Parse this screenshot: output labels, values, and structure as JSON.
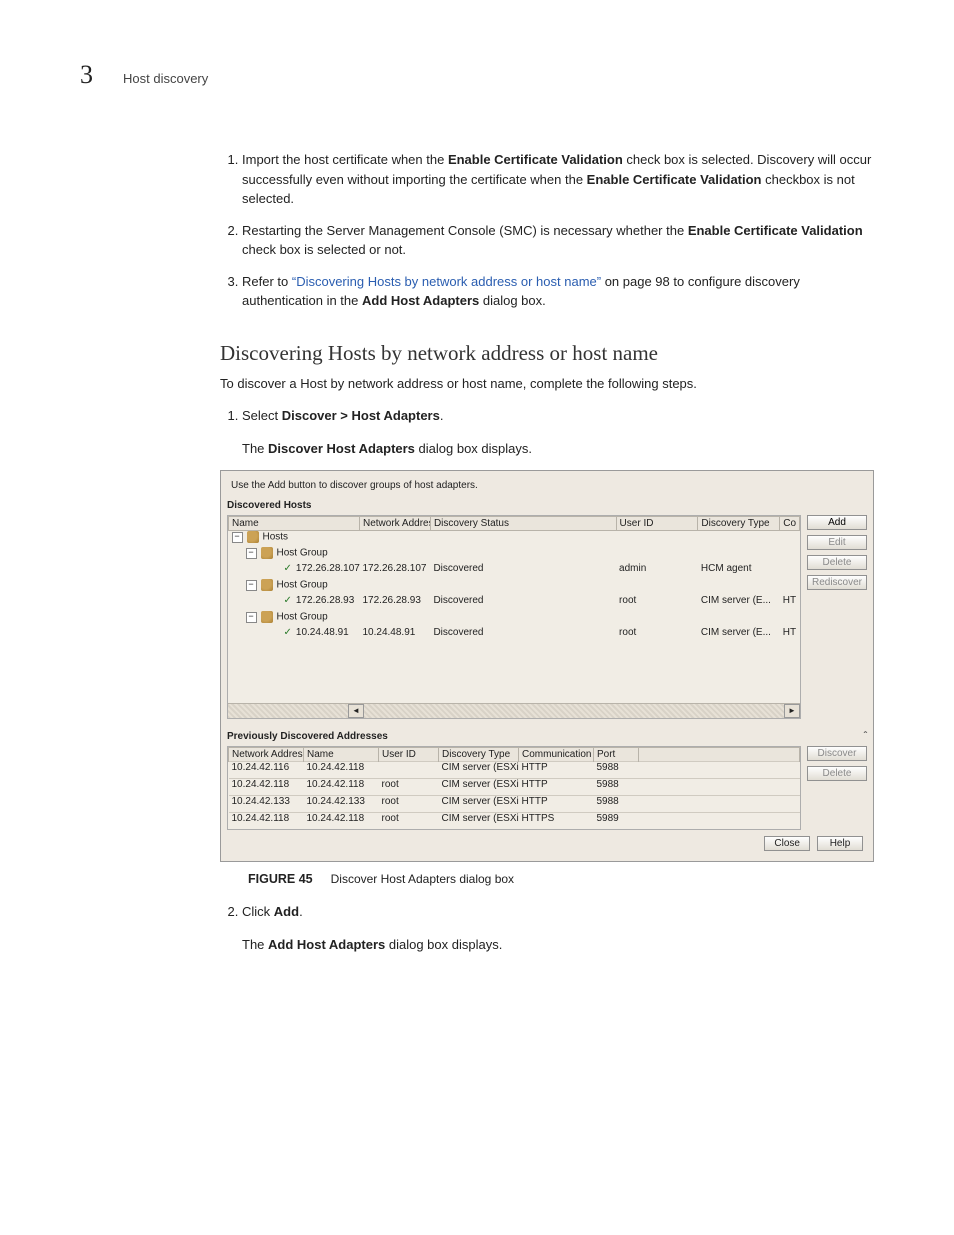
{
  "header": {
    "chapter_number": "3",
    "chapter_title": "Host discovery"
  },
  "intro_list": {
    "item1_pre": "Import the host certificate when the ",
    "item1_b1": "Enable Certificate Validation",
    "item1_mid": " check box is selected. Discovery will occur successfully even without importing the certificate when the ",
    "item1_b2": "Enable Certificate Validation",
    "item1_post": " checkbox is not selected.",
    "item2_pre": "Restarting the Server Management Console (SMC) is necessary whether the ",
    "item2_b": "Enable Certificate Validation",
    "item2_post": " check box is selected or not.",
    "item3_pre": "Refer to ",
    "item3_link": "“Discovering Hosts by network address or host name”",
    "item3_mid": " on page 98 to configure discovery authentication in the ",
    "item3_b": "Add Host Adapters",
    "item3_post": " dialog box."
  },
  "section_heading": "Discovering Hosts by network address or host name",
  "section_intro": "To discover a Host by network address or host name, complete the following steps.",
  "step1_pre": "Select ",
  "step1_b": "Discover > Host Adapters",
  "step1_post": ".",
  "step1_sub_pre": "The ",
  "step1_sub_b": "Discover Host Adapters",
  "step1_sub_post": " dialog box displays.",
  "screenshot": {
    "hint": "Use the Add button to discover groups of host adapters.",
    "discovered_title": "Discovered Hosts",
    "cols": {
      "name": "Name",
      "netaddr": "Network Address",
      "status": "Discovery Status",
      "user": "User ID",
      "dtype": "Discovery Type",
      "co": "Co"
    },
    "tree": {
      "root": "Hosts",
      "g1": "Host Group",
      "h1_name": "172.26.28.107",
      "h1_addr": "172.26.28.107",
      "h1_status": "Discovered",
      "h1_user": "admin",
      "h1_dtype": "HCM agent",
      "g2": "Host Group",
      "h2_name": "172.26.28.93",
      "h2_addr": "172.26.28.93",
      "h2_status": "Discovered",
      "h2_user": "root",
      "h2_dtype": "CIM server (E...",
      "h2_co": "HT",
      "g3": "Host Group",
      "h3_name": "10.24.48.91",
      "h3_addr": "10.24.48.91",
      "h3_status": "Discovered",
      "h3_user": "root",
      "h3_dtype": "CIM server (E...",
      "h3_co": "HT"
    },
    "buttons": {
      "add": "Add",
      "edit": "Edit",
      "delete": "Delete",
      "rediscover": "Rediscover",
      "discover": "Discover",
      "delete2": "Delete",
      "close": "Close",
      "help": "Help"
    },
    "prev_title": "Previously Discovered Addresses",
    "prev_cols": {
      "addr": "Network Address",
      "name": "Name",
      "user": "User ID",
      "dtype": "Discovery Type",
      "comm": "Communication pr...",
      "port": "Port"
    },
    "prev_rows": [
      {
        "addr": "10.24.42.116",
        "name": "10.24.42.118",
        "user": "",
        "dtype": "CIM server (ESXi ...",
        "comm": "HTTP",
        "port": "5988"
      },
      {
        "addr": "10.24.42.118",
        "name": "10.24.42.118",
        "user": "root",
        "dtype": "CIM server (ESXi ...",
        "comm": "HTTP",
        "port": "5988"
      },
      {
        "addr": "10.24.42.133",
        "name": "10.24.42.133",
        "user": "root",
        "dtype": "CIM server (ESXi ...",
        "comm": "HTTP",
        "port": "5988"
      },
      {
        "addr": "10.24.42.118",
        "name": "10.24.42.118",
        "user": "root",
        "dtype": "CIM server (ESXi ...",
        "comm": "HTTPS",
        "port": "5989"
      }
    ]
  },
  "figure": {
    "label": "FIGURE 45",
    "caption": "Discover Host Adapters dialog box"
  },
  "step2_pre": "Click ",
  "step2_b": "Add",
  "step2_post": ".",
  "step2_sub_pre": "The ",
  "step2_sub_b": "Add Host Adapters",
  "step2_sub_post": " dialog box displays."
}
